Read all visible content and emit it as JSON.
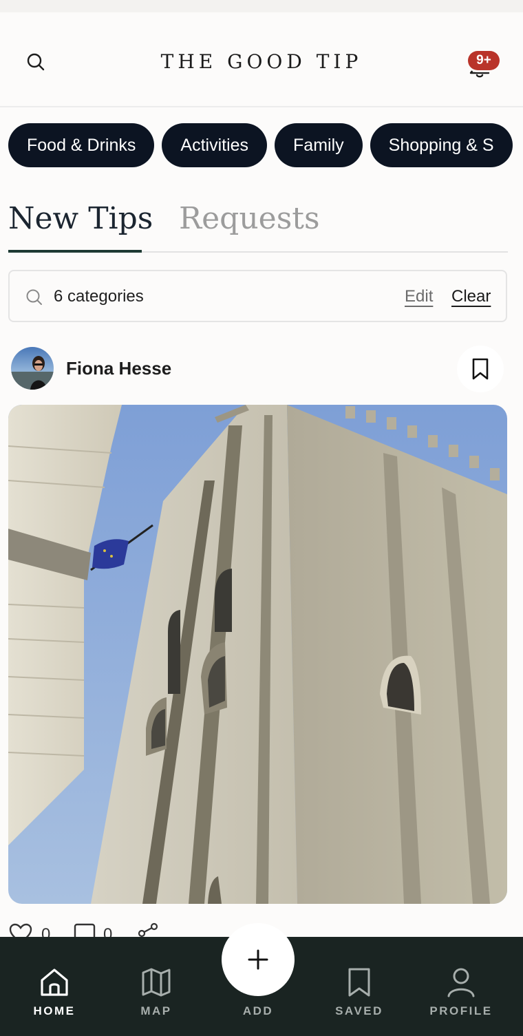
{
  "header": {
    "title": "THE GOOD TIP",
    "notification_badge": "9+",
    "badge_color": "#b9342a"
  },
  "categories": [
    {
      "label": "Food & Drinks"
    },
    {
      "label": "Activities"
    },
    {
      "label": "Family"
    },
    {
      "label": "Shopping & S"
    }
  ],
  "tabs": [
    {
      "label": "New Tips",
      "active": true
    },
    {
      "label": "Requests",
      "active": false
    }
  ],
  "filter": {
    "text": "6 categories",
    "edit_label": "Edit",
    "clear_label": "Clear"
  },
  "post": {
    "author": "Fiona Hesse",
    "likes": "0",
    "comments": "0"
  },
  "bottom_nav": {
    "items": [
      {
        "label": "HOME",
        "icon": "home-icon",
        "active": true
      },
      {
        "label": "MAP",
        "icon": "map-icon",
        "active": false
      },
      {
        "label": "ADD",
        "icon": "plus-icon",
        "active": false
      },
      {
        "label": "SAVED",
        "icon": "bookmark-icon",
        "active": false
      },
      {
        "label": "PROFILE",
        "icon": "user-icon",
        "active": false
      }
    ]
  },
  "colors": {
    "chip_bg": "#0c1422",
    "nav_bg": "#1a2422",
    "tab_underline": "#1d3a33"
  }
}
